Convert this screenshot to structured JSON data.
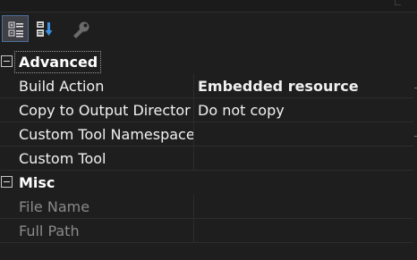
{
  "toolbar": {
    "categorized_icon": "categorized-icon",
    "alphabetical_icon": "alphabetical-icon",
    "property_pages_icon": "wrench-icon"
  },
  "categories": [
    {
      "title": "Advanced",
      "properties": [
        {
          "name": "Build Action",
          "value": "Embedded resource",
          "bold": true
        },
        {
          "name": "Copy to Output Director",
          "value": "Do not copy"
        },
        {
          "name": "Custom Tool Namespace",
          "value": ""
        },
        {
          "name": "Custom Tool",
          "value": ""
        }
      ]
    },
    {
      "title": "Misc",
      "properties": [
        {
          "name": "File Name",
          "value": "",
          "disabled": true
        },
        {
          "name": "Full Path",
          "value": "",
          "disabled": true
        }
      ]
    }
  ],
  "colors": {
    "background": "#1e1e1e",
    "grid_line": "#2d2d30",
    "text": "#f1f1f1",
    "disabled_text": "#8a8a8a",
    "active_button": "#3f3f46"
  }
}
